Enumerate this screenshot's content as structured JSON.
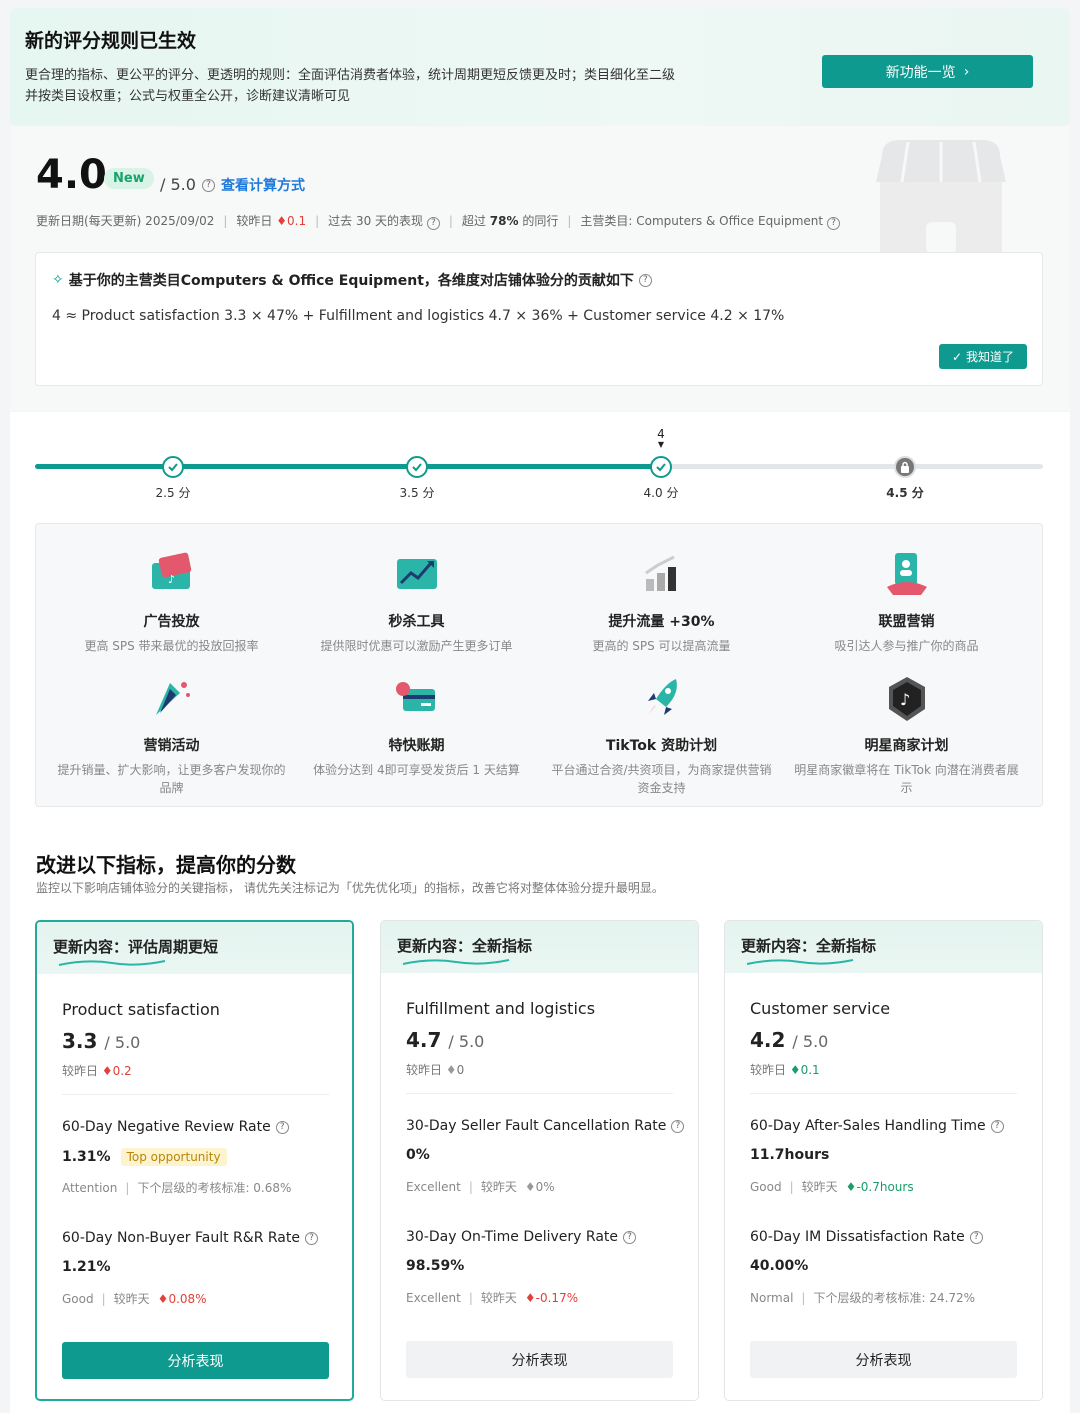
{
  "banner": {
    "title": "新的评分规则已生效",
    "line1": "更合理的指标、更公平的评分、更透明的规则：全面评估消费者体验，统计周期更短反馈更及时；类目细化至二级",
    "line2": "并按类目设权重；公式与权重全公开，诊断建议清晰可见",
    "button": "新功能一览"
  },
  "score": {
    "value": "4.0",
    "badge": "New",
    "max": "/ 5.0",
    "help_link": "查看计算方式",
    "update_date": "更新日期(每天更新) 2025/09/02",
    "vs_yesterday_label": "较昨日",
    "vs_yesterday_value": "0.1",
    "past30": "过去 30 天的表现",
    "beat_peers_prefix": "超过",
    "beat_peers_value": "78%",
    "beat_peers_suffix": "的同行",
    "category": "主营类目: Computers & Office Equipment"
  },
  "formula": {
    "title": "基于你的主营类目Computers & Office Equipment，各维度对店铺体验分的贡献如下",
    "text": "4 ≈ Product satisfaction 3.3 × 47% + Fulfillment and logistics 4.7 × 36% + Customer service 4.2 × 17%",
    "ok_button": "我知道了"
  },
  "progress": {
    "current_marker": "4",
    "value": 4.0,
    "nodes": [
      {
        "label": "2.5 分",
        "status": "done"
      },
      {
        "label": "3.5 分",
        "status": "done"
      },
      {
        "label": "4.0 分",
        "status": "done"
      },
      {
        "label": "4.5 分",
        "status": "locked"
      }
    ]
  },
  "benefits": [
    {
      "icon": "ad-card-icon",
      "title": "广告投放",
      "desc": "更高 SPS 带来最优的投放回报率"
    },
    {
      "icon": "flash-sale-chart-icon",
      "title": "秒杀工具",
      "desc": "提供限时优惠可以激励产生更多订单"
    },
    {
      "icon": "traffic-growth-icon",
      "title": "提升流量 +30%",
      "desc": "更高的 SPS 可以提高流量"
    },
    {
      "icon": "affiliate-badge-icon",
      "title": "联盟营销",
      "desc": "吸引达人参与推广你的商品"
    },
    {
      "icon": "megaphone-icon",
      "title": "营销活动",
      "desc": "提升销量、扩大影响，让更多客户发现你的品牌"
    },
    {
      "icon": "fast-payment-icon",
      "title": "特快账期",
      "desc": "体验分达到 4即可享受发货后 1 天结算"
    },
    {
      "icon": "rocket-icon",
      "title": "TikTok 资助计划",
      "desc": "平台通过合资/共资项目，为商家提供营销资金支持"
    },
    {
      "icon": "tiktok-star-icon",
      "title": "明星商家计划",
      "desc": "明星商家徽章将在 TikTok 向潜在消费者展示"
    }
  ],
  "improve": {
    "title": "改进以下指标，提高你的分数",
    "subtitle": "监控以下影响店铺体验分的关键指标，  请优先关注标记为「优先优化项」的指标，改善它将对整体体验分提升最明显。",
    "cards": [
      {
        "header": "更新内容：评估周期更短",
        "name": "Product satisfaction",
        "score": "3.3",
        "max": "/ 5.0",
        "delta_label": "较昨日",
        "delta_value": "0.2",
        "indicators": [
          {
            "name": "60-Day Negative Review Rate",
            "value": "1.31%",
            "tag": "Top opportunity",
            "status": "Attention",
            "extra": "下个层级的考核标准: 0.68%"
          },
          {
            "name": "60-Day Non-Buyer Fault R&R Rate",
            "value": "1.21%",
            "status": "Good",
            "extra_label": "较昨天",
            "extra_value": "0.08%"
          }
        ],
        "button": "分析表现"
      },
      {
        "header": "更新内容：全新指标",
        "name": "Fulfillment and logistics",
        "score": "4.7",
        "max": "/ 5.0",
        "delta_label": "较昨日",
        "delta_value": "0",
        "indicators": [
          {
            "name": "30-Day Seller Fault Cancellation Rate",
            "value": "0%",
            "status": "Excellent",
            "extra_label": "较昨天",
            "extra_value": "0%"
          },
          {
            "name": "30-Day On-Time Delivery Rate",
            "value": "98.59%",
            "status": "Excellent",
            "extra_label": "较昨天",
            "extra_value": "-0.17%"
          }
        ],
        "button": "分析表现"
      },
      {
        "header": "更新内容：全新指标",
        "name": "Customer service",
        "score": "4.2",
        "max": "/ 5.0",
        "delta_label": "较昨日",
        "delta_value": "0.1",
        "indicators": [
          {
            "name": "60-Day After-Sales Handling Time",
            "value": "11.7hours",
            "status": "Good",
            "extra_label": "较昨天",
            "extra_value": "-0.7hours"
          },
          {
            "name": "60-Day IM Dissatisfaction Rate",
            "value": "40.00%",
            "status": "Normal",
            "extra": "下个层级的考核标准: 24.72%"
          }
        ],
        "button": "分析表现"
      }
    ]
  },
  "colors": {
    "accent": "#0f9a8f",
    "negative": "#e0413a",
    "positive": "#1a9d6b",
    "tag_bg": "#fdf3cc"
  }
}
